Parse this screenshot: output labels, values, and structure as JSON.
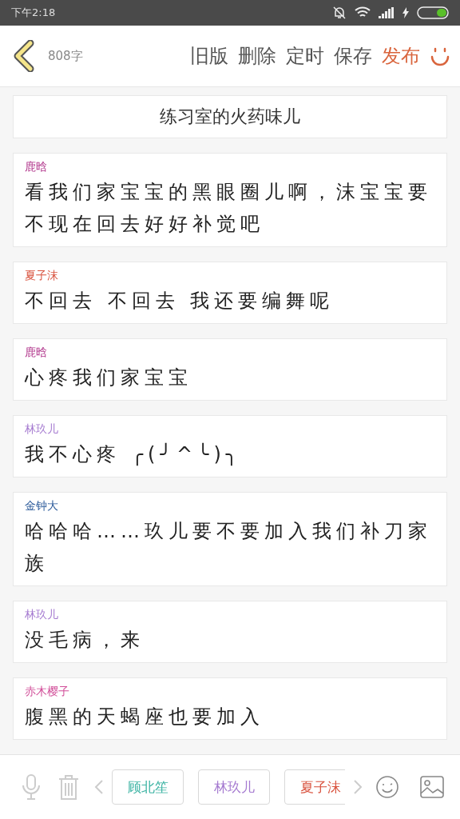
{
  "status_bar": {
    "time": "下午2:18"
  },
  "header": {
    "word_count": "808字",
    "actions": [
      {
        "label": "旧版",
        "kind": "plain"
      },
      {
        "label": "删除",
        "kind": "plain"
      },
      {
        "label": "定时",
        "kind": "plain"
      },
      {
        "label": "保存",
        "kind": "plain"
      },
      {
        "label": "发布",
        "kind": "accent"
      }
    ]
  },
  "title": "练习室的火药味儿",
  "messages": [
    {
      "name": "鹿晗",
      "color": "#b0338a",
      "text": "看我们家宝宝的黑眼圈儿啊，沫宝宝要不现在回去好好补觉吧"
    },
    {
      "name": "夏子沫",
      "color": "#d9533f",
      "text": "不回去  不回去  我还要编舞呢"
    },
    {
      "name": "鹿晗",
      "color": "#b0338a",
      "text": "心疼我们家宝宝"
    },
    {
      "name": "林玖儿",
      "color": "#a57ad0",
      "text": "我不心疼 ╭(╯^╰)╮"
    },
    {
      "name": "金钟大",
      "color": "#2b5a9a",
      "text": "哈哈哈……玖儿要不要加入我们补刀家族"
    },
    {
      "name": "林玖儿",
      "color": "#a57ad0",
      "text": "没毛病，来"
    },
    {
      "name": "赤木樱子",
      "color": "#d2509a",
      "text": "腹黑的天蝎座也要加入"
    }
  ],
  "characters": [
    {
      "name": "顾北笙",
      "color": "#3bb3a3"
    },
    {
      "name": "林玖儿",
      "color": "#a57ad0"
    },
    {
      "name": "夏子沫",
      "color": "#d9533f"
    }
  ]
}
